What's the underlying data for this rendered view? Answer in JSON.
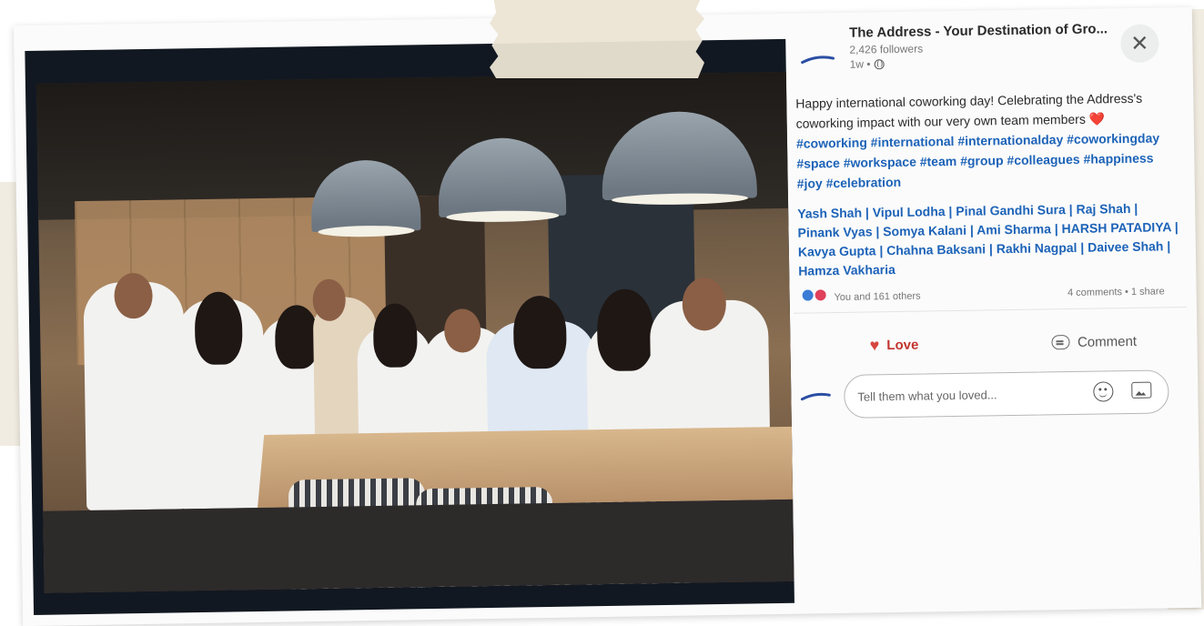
{
  "post": {
    "author": "The Address - Your Destination of Gro...",
    "followers": "2,426 followers",
    "time": "1w •",
    "close_symbol": "✕",
    "text_intro": "Happy international coworking day! Celebrating the Address's coworking impact with our very own team members",
    "heart_emoji": "❤️",
    "hashtags": "#coworking #international #internationalday #coworkingday #space #workspace #team #group #colleagues #happiness #joy #celebration",
    "names": "Yash Shah | Vipul Lodha | Pinal Gandhi Sura | Raj Shah | Pinank Vyas | Somya Kalani | Ami Sharma | HARSH PATADIYA | Kavya Gupta | Chahna Baksani | Rakhi Nagpal | Daivee Shah | Hamza Vakharia"
  },
  "stats": {
    "reactions": "You and 161 others",
    "comments_shares": "4 comments • 1 share"
  },
  "actions": {
    "love_label": "Love",
    "comment_label": "Comment"
  },
  "compose": {
    "placeholder": "Tell them what you loved..."
  },
  "colors": {
    "link_blue": "#1d63b8",
    "love_red": "#c2362e",
    "tape": "#ece5d5"
  },
  "icons": [
    "globe-icon",
    "close-icon",
    "heart-icon",
    "comment-icon",
    "emoji-icon",
    "image-icon",
    "like-reaction-icon",
    "love-reaction-icon"
  ]
}
